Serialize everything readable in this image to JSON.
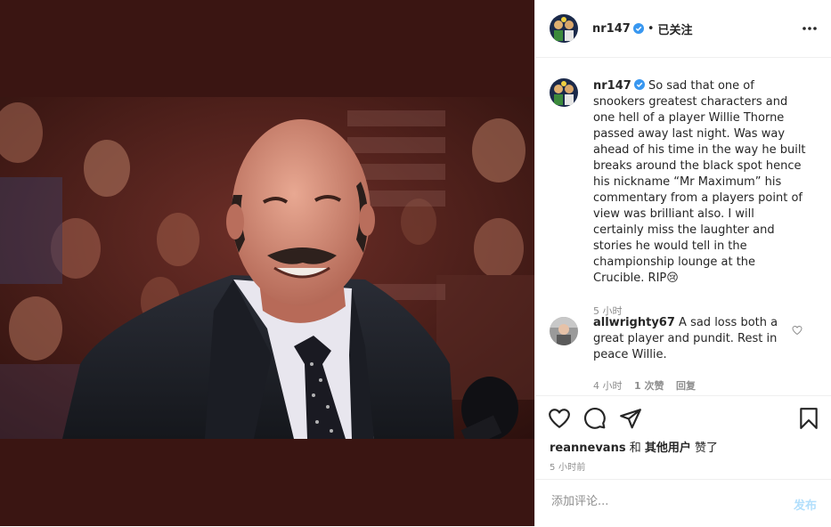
{
  "header": {
    "username": "nr147",
    "separator": "•",
    "follow_status": "已关注"
  },
  "caption": {
    "username": "nr147",
    "text": "So sad that one of snookers greatest characters and one hell of a player Willie Thorne passed away last night. Was way ahead of his time in the way he built breaks around the black spot hence his nickname “Mr Maximum” his commentary from a players point of view was brilliant also. I will certainly miss the laughter and stories he would tell in the championship lounge at the Crucible. RIP",
    "emoji": "😢",
    "time": "5 小时"
  },
  "comment": {
    "username": "allwrighty67",
    "text": "A sad loss both a great player and pundit. Rest in peace Willie.",
    "time": "4 小时",
    "likes": "1 次赞",
    "reply": "回复"
  },
  "likes": {
    "user": "reannevans",
    "and": "和",
    "others": "其他用户",
    "suffix": "赞了"
  },
  "posted_time": "5 小时前",
  "add_comment": {
    "placeholder": "添加评论...",
    "post_label": "发布"
  },
  "colors": {
    "verified": "#3897f0",
    "photo_bg": "#3a1512",
    "post_button": "#b2dffc"
  }
}
